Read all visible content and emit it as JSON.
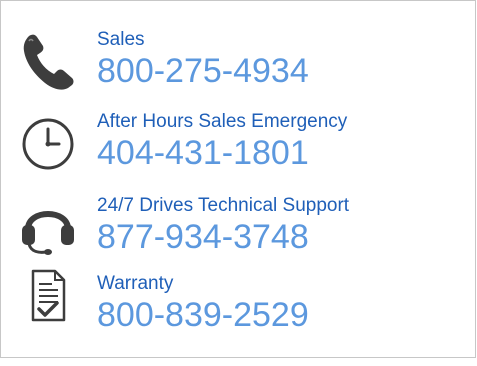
{
  "contacts": [
    {
      "icon": "phone-icon",
      "label": "Sales",
      "phone": "800-275-4934"
    },
    {
      "icon": "clock-icon",
      "label": "After Hours Sales Emergency",
      "phone": "404-431-1801"
    },
    {
      "icon": "headset-icon",
      "label": "24/7 Drives Technical Support",
      "phone": "877-934-3748"
    },
    {
      "icon": "warranty-document-icon",
      "label": "Warranty",
      "phone": "800-839-2529"
    }
  ],
  "colors": {
    "label": "#1f5fb8",
    "phone": "#5c98de",
    "icon": "#3d3d3d",
    "border": "#c7c7c7"
  }
}
